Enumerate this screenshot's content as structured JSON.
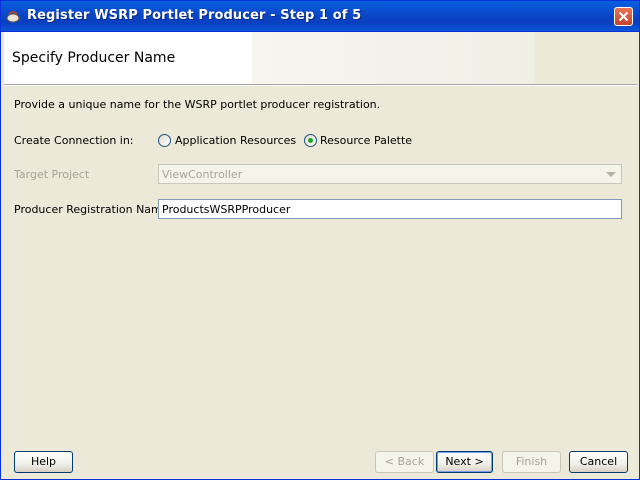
{
  "window": {
    "title": "Register WSRP Portlet Producer - Step 1 of 5"
  },
  "header": {
    "title": "Specify Producer Name"
  },
  "form": {
    "description": "Provide a unique name for the WSRP portlet producer registration.",
    "create_connection_label": "Create Connection in:",
    "radio_application_resources": "Application Resources",
    "radio_resource_palette": "Resource Palette",
    "selected_radio": "Resource Palette",
    "target_project_label": "Target Project",
    "target_project_value": "ViewController",
    "registration_name_label": "Producer Registration Name:",
    "registration_name_value": "ProductsWSRPProducer"
  },
  "buttons": {
    "help": "Help",
    "back": "< Back",
    "next": "Next >",
    "finish": "Finish",
    "cancel": "Cancel"
  },
  "colors": {
    "titlebar": "#0a47c9",
    "dialog_bg": "#ece9d8",
    "radio_selected_dot": "#21a121"
  }
}
